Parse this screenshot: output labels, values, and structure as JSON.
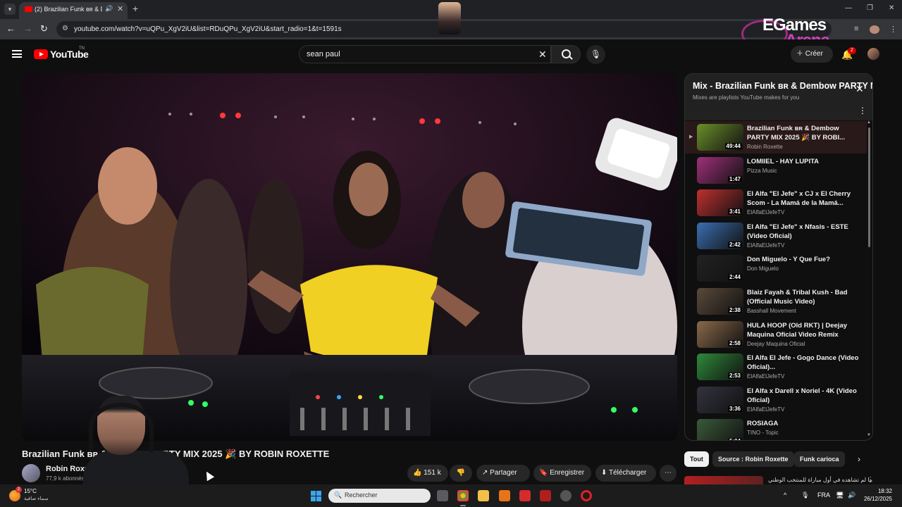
{
  "browser": {
    "tab_title": "(2) Brazilian Funk ʙʀ & Demb",
    "tab_audio_icon": "speaker-icon",
    "url": "youtube.com/watch?v=uQPu_XgV2iU&list=RDuQPu_XgV2iU&start_radio=1&t=1591s"
  },
  "overlay": {
    "brand_line1": "EGames",
    "brand_line2": "Arena"
  },
  "youtube_header": {
    "logo_text": "YouTube",
    "logo_tm": "TN",
    "search_value": "sean paul",
    "create_label": "Créer",
    "notification_count": "2"
  },
  "video": {
    "title": "Brazilian Funk ʙʀ & Dembow PARTY MIX 2025 🎉 BY ROBIN ROXETTE",
    "channel": "Robin Roxette",
    "subscribers": "77,9 k abonnés",
    "likes": "151 k",
    "share_label": "Partager",
    "save_label": "Enregistrer",
    "download_label": "Télécharger"
  },
  "playlist": {
    "title": "Mix - Brazilian Funk ʙʀ & Dembow PARTY MIX 2025",
    "subtitle": "Mixes are playlists YouTube makes for you",
    "items": [
      {
        "title": "Brazilian Funk ʙʀ & Dembow PARTY MIX 2025 🎉 BY ROBI...",
        "channel": "Robin Roxette",
        "duration": "49:44",
        "thumb": "#6b8f2a"
      },
      {
        "title": "LOMIIEL - HAY LUPITA",
        "channel": "Pizza Music",
        "duration": "1:47",
        "thumb": "#a0307a"
      },
      {
        "title": "El Alfa \"El Jefe\" x CJ x El Cherry Scom - La Mamá de la Mamá...",
        "channel": "ElAlfaElJefeTV",
        "duration": "3:41",
        "thumb": "#c03030"
      },
      {
        "title": "El Alfa \"El Jefe\" x Nfasis - ESTE (Video Oficial)",
        "channel": "ElAlfaElJefeTV",
        "duration": "2:42",
        "thumb": "#3a6fb0"
      },
      {
        "title": "Don Miguelo - Y Que Fue?",
        "channel": "Don Miguelo",
        "duration": "2:44",
        "thumb": "#222222"
      },
      {
        "title": "Blaiz Fayah & Tribal Kush - Bad (Official Music Video)",
        "channel": "Basshall Movement",
        "duration": "2:38",
        "thumb": "#5a4a3a"
      },
      {
        "title": "HULA HOOP (Old RKT) | Deejay Maquina Oficial Video Remix",
        "channel": "Deejay Maquina Oficial",
        "duration": "2:58",
        "thumb": "#8a6a4a"
      },
      {
        "title": "El Alfa El Jefe - Gogo Dance (Video Oficial)...",
        "channel": "ElAlfaElJefeTV",
        "duration": "2:53",
        "thumb": "#2f8a3a"
      },
      {
        "title": "El Alfa x Darell x Noriel - 4K (Video Oficial)",
        "channel": "ElAlfaElJefeTV",
        "duration": "3:36",
        "thumb": "#333340"
      },
      {
        "title": "ROSIAGA",
        "channel": "TINO - Topic",
        "duration": "5:04",
        "thumb": "#3a5a3a"
      }
    ]
  },
  "chips": [
    "Tout",
    "Source : Robin Roxette",
    "Funk carioca"
  ],
  "rec_peek_text": "ما لم تشاهده في أول مباراة للمنتخب الوطني",
  "taskbar": {
    "temperature": "15°C",
    "condition": "سماء صافية",
    "weather_badge": "2",
    "search_placeholder": "Rechercher",
    "language": "FRA",
    "time": "18:32",
    "date": "26/12/2025"
  },
  "colors": {
    "youtube_red": "#ff0000",
    "bg": "#0f0f0f",
    "panel_head": "#212121",
    "brand_pink": "#d63fbf"
  }
}
